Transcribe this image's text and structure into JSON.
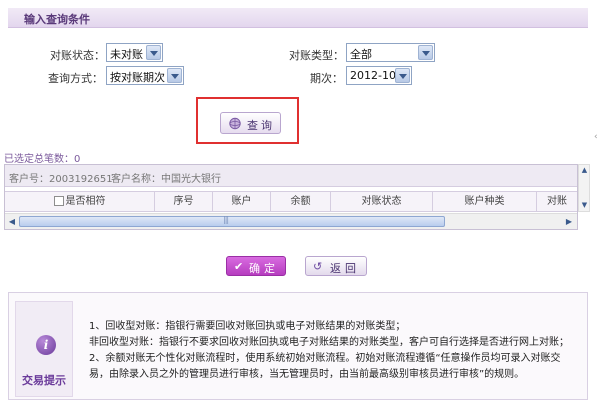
{
  "section": {
    "title": "输入查询条件"
  },
  "form": {
    "status_label": "对账状态：",
    "status_value": "未对账",
    "type_label": "对账类型：",
    "type_value": "全部",
    "method_label": "查询方式：",
    "method_value": "按对账期次",
    "period_label": "期次：",
    "period_value": "2012-10"
  },
  "query_button": {
    "label": "查询"
  },
  "selected": {
    "text": "已选定总笔数：0"
  },
  "grid": {
    "customer_no": "客户号：2003192651",
    "customer_name": "客户名称：中国光大银行",
    "columns": [
      "是否相符",
      "序号",
      "账户",
      "余额",
      "对账状态",
      "账户种类",
      "对账"
    ]
  },
  "buttons": {
    "ok": "确定",
    "back": "返回"
  },
  "tips": {
    "title": "交易提示",
    "lines": [
      "1、回收型对账：指银行需要回收对账回执或电子对账结果的对账类型；",
      "非回收型对账：指银行不要求回收对账回执或电子对账结果的对账类型，客户可自行选择是否进行网上对账；",
      "2、余额对账无个性化对账流程时，使用系统初始对账流程。初始对账流程遵循“任意操作员均可录入对账交易，由除录入员之外的管理员进行审核，当无管理员时，由当前最高级别审核员进行审核”的规则。"
    ]
  },
  "colors": {
    "accent": "#6a3a9a",
    "highlight": "#e03030",
    "ok_button": "#c24fcb"
  }
}
